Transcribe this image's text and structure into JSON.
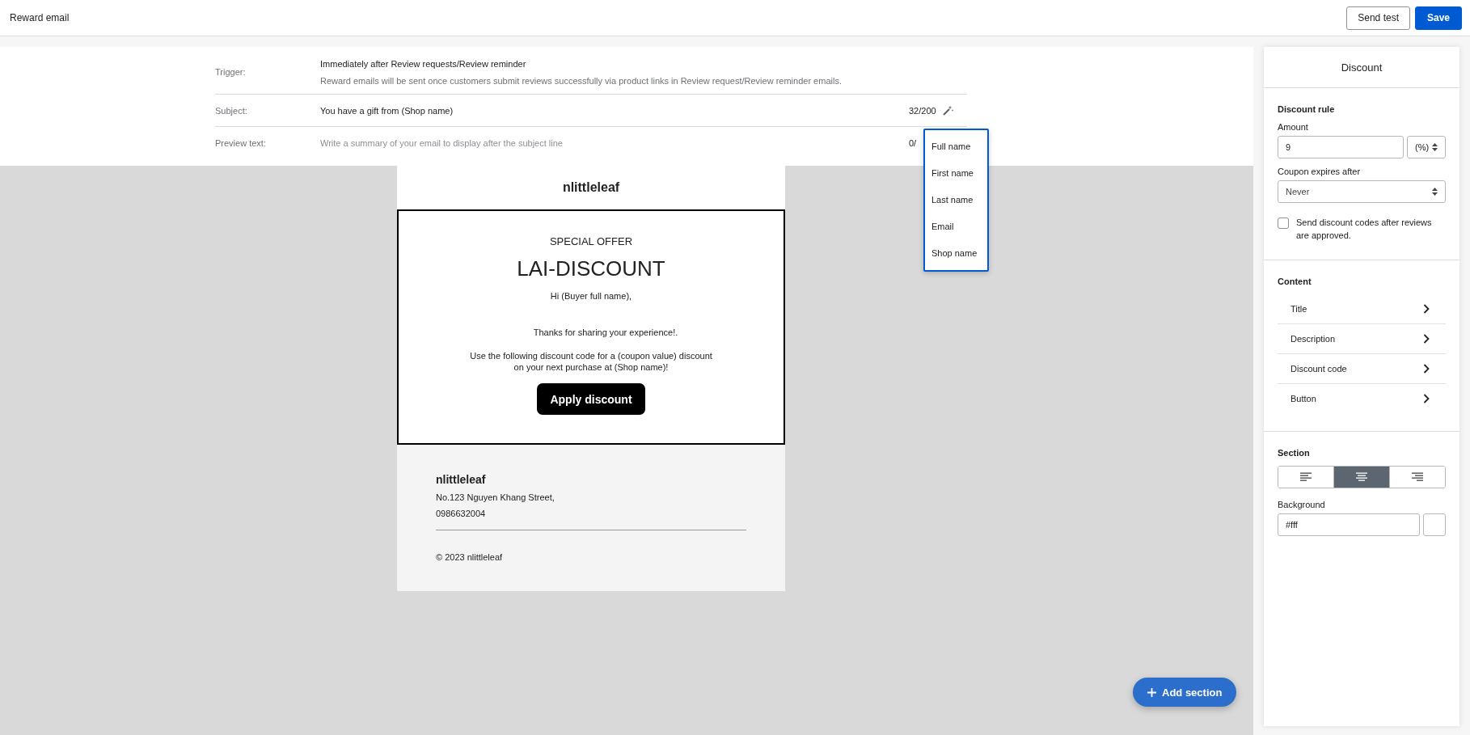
{
  "header": {
    "title": "Reward email",
    "buttons": [
      {
        "label": "Send test",
        "kind": "secondary"
      },
      {
        "label": "Save",
        "kind": "primary"
      }
    ]
  },
  "settings": [
    {
      "kind": "text",
      "label": "Trigger:",
      "value": "Immediately after Review requests/Review reminder",
      "note": "Reward emails will be sent once customers submit reviews successfully via product links in Review request/Review reminder emails."
    },
    {
      "kind": "input",
      "label": "Subject:",
      "value": "You have a gift from (Shop name)",
      "counter": "32/200",
      "tool": true
    },
    {
      "kind": "input",
      "label": "Preview text:",
      "placeholder": "Write a summary of your email to display after the subject line",
      "counter": "0/"
    }
  ],
  "variables_menu": {
    "items": [
      "Full name",
      "First name",
      "Last name",
      "Email",
      "Shop name"
    ]
  },
  "email": {
    "brand": "nlittleleaf",
    "eyebrow": "SPECIAL OFFER",
    "code": "LAI-DISCOUNT",
    "greeting": "Hi (Buyer full name),",
    "thanks": "Thanks for sharing your experience!.",
    "body": [
      "Use the following discount code for a (coupon value) discount",
      "on your next purchase at (Shop name)!"
    ],
    "button": "Apply discount",
    "footer": {
      "name": "nlittleleaf",
      "address": "No.123 Nguyen Khang Street,",
      "phone": "0986632004",
      "copyright": "© 2023 nlittleleaf"
    }
  },
  "add_section": {
    "label": "Add section"
  },
  "panel": {
    "title": "Discount",
    "discount_rule": {
      "heading": "Discount rule",
      "amount_label": "Amount",
      "amount": "9",
      "unit": "(%)",
      "expires_label": "Coupon expires after",
      "expires": "Never",
      "approval": {
        "label": "Send discount codes after reviews are approved.",
        "checked": false
      }
    },
    "content": {
      "heading": "Content",
      "items": [
        "Title",
        "Description",
        "Discount code",
        "Button"
      ]
    },
    "section": {
      "heading": "Section",
      "alignments": [
        {
          "kind": "left",
          "selected": false
        },
        {
          "kind": "center",
          "selected": true
        },
        {
          "kind": "right",
          "selected": false
        }
      ],
      "background_label": "Background",
      "background": "#fff"
    }
  }
}
